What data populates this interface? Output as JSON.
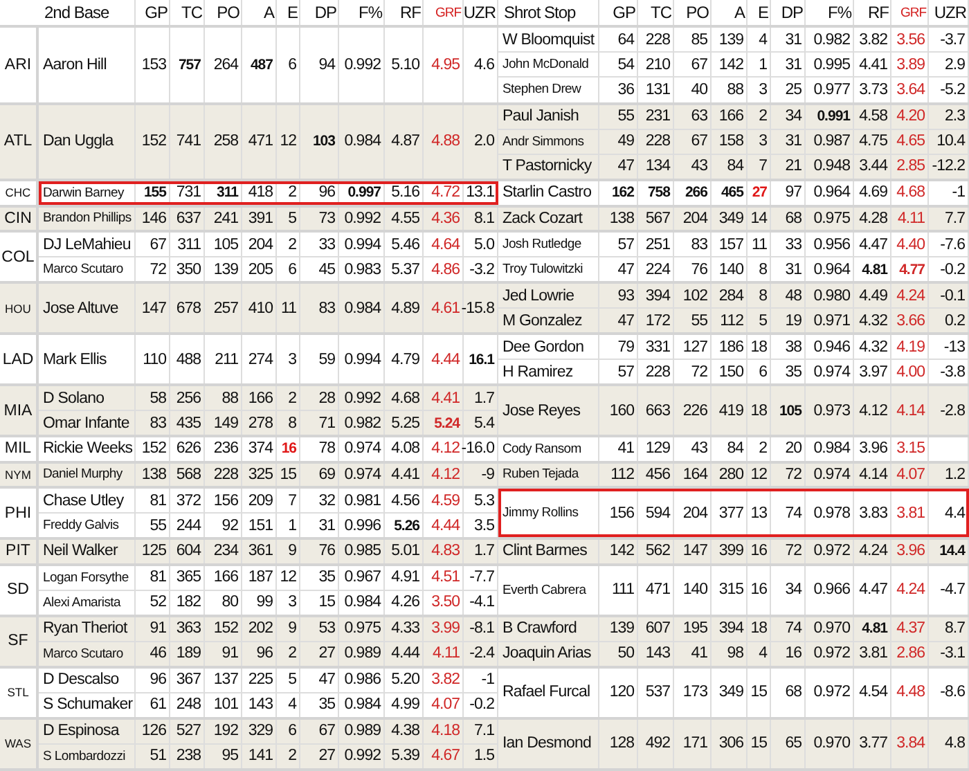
{
  "sections": {
    "second_base": {
      "title": "2nd Base",
      "columns": [
        {
          "label": "GP",
          "accent": false
        },
        {
          "label": "TC",
          "accent": false
        },
        {
          "label": "PO",
          "accent": false
        },
        {
          "label": "A",
          "accent": false
        },
        {
          "label": "E",
          "accent": false
        },
        {
          "label": "DP",
          "accent": false
        },
        {
          "label": "F%",
          "accent": false
        },
        {
          "label": "RF",
          "accent": false
        },
        {
          "label": "GRF",
          "accent": true
        },
        {
          "label": "UZR",
          "accent": false
        }
      ]
    },
    "shortstop": {
      "title": "Shrot Stop",
      "columns": [
        {
          "label": "GP",
          "accent": false
        },
        {
          "label": "TC",
          "accent": false
        },
        {
          "label": "PO",
          "accent": false
        },
        {
          "label": "A",
          "accent": false
        },
        {
          "label": "E",
          "accent": false
        },
        {
          "label": "DP",
          "accent": false
        },
        {
          "label": "F%",
          "accent": false
        },
        {
          "label": "RF",
          "accent": false
        },
        {
          "label": "GRF",
          "accent": true
        },
        {
          "label": "UZR",
          "accent": false
        }
      ]
    }
  },
  "teams": [
    {
      "team": "ARI",
      "small": false,
      "second_base": [
        {
          "name": "Aaron Hill",
          "small": false,
          "highlighted": false,
          "stats": [
            "153",
            {
              "value": "757",
              "bold": true
            },
            "264",
            {
              "value": "487",
              "bold": true
            },
            "6",
            "94",
            "0.992",
            "5.10",
            "4.95",
            "4.6"
          ]
        }
      ],
      "shortstop": [
        {
          "name": "W Bloomquist",
          "small": false,
          "highlighted": false,
          "stats": [
            "64",
            "228",
            "85",
            "139",
            "4",
            "31",
            "0.982",
            "3.82",
            "3.56",
            "-3.7"
          ]
        },
        {
          "name": "John McDonald",
          "small": true,
          "highlighted": false,
          "stats": [
            "54",
            "210",
            "67",
            "142",
            "1",
            "31",
            "0.995",
            "4.41",
            "3.89",
            "2.9"
          ]
        },
        {
          "name": "Stephen Drew",
          "small": true,
          "highlighted": false,
          "stats": [
            "36",
            "131",
            "40",
            "88",
            "3",
            "25",
            "0.977",
            "3.73",
            "3.64",
            "-5.2"
          ]
        }
      ]
    },
    {
      "team": "ATL",
      "small": false,
      "second_base": [
        {
          "name": "Dan Uggla",
          "small": false,
          "highlighted": false,
          "stats": [
            "152",
            "741",
            "258",
            "471",
            "12",
            {
              "value": "103",
              "bold": true
            },
            "0.984",
            "4.87",
            "4.88",
            "2.0"
          ]
        }
      ],
      "shortstop": [
        {
          "name": "Paul Janish",
          "small": false,
          "highlighted": false,
          "stats": [
            "55",
            "231",
            "63",
            "166",
            "2",
            "34",
            {
              "value": "0.991",
              "bold": true
            },
            "4.58",
            "4.20",
            "2.3"
          ]
        },
        {
          "name": "Andr Simmons",
          "small": true,
          "highlighted": false,
          "stats": [
            "49",
            "228",
            "67",
            "158",
            "3",
            "31",
            "0.987",
            "4.75",
            "4.65",
            "10.4"
          ]
        },
        {
          "name": "T Pastornicky",
          "small": false,
          "highlighted": false,
          "stats": [
            "47",
            "134",
            "43",
            "84",
            "7",
            "21",
            "0.948",
            "3.44",
            "2.85",
            "-12.2"
          ]
        }
      ]
    },
    {
      "team": "CHC",
      "small": true,
      "second_base": [
        {
          "name": "Darwin Barney",
          "small": true,
          "highlighted": true,
          "stats": [
            {
              "value": "155",
              "bold": true
            },
            "731",
            {
              "value": "311",
              "bold": true
            },
            "418",
            "2",
            "96",
            {
              "value": "0.997",
              "bold": true
            },
            "5.16",
            "4.72",
            "13.1"
          ]
        }
      ],
      "shortstop": [
        {
          "name": "Starlin Castro",
          "small": false,
          "highlighted": false,
          "stats": [
            {
              "value": "162",
              "bold": true
            },
            {
              "value": "758",
              "bold": true
            },
            {
              "value": "266",
              "bold": true
            },
            {
              "value": "465",
              "bold": true
            },
            {
              "value": "27",
              "bold": true,
              "alert": true
            },
            "97",
            "0.964",
            "4.69",
            "4.68",
            "-1"
          ]
        }
      ]
    },
    {
      "team": "CIN",
      "small": false,
      "second_base": [
        {
          "name": "Brandon Phillips",
          "small": true,
          "highlighted": false,
          "stats": [
            "146",
            "637",
            "241",
            "391",
            "5",
            "73",
            "0.992",
            "4.55",
            "4.36",
            "8.1"
          ]
        }
      ],
      "shortstop": [
        {
          "name": "Zack Cozart",
          "small": false,
          "highlighted": false,
          "stats": [
            "138",
            "567",
            "204",
            "349",
            "14",
            "68",
            "0.975",
            "4.28",
            "4.11",
            "7.7"
          ]
        }
      ]
    },
    {
      "team": "COL",
      "small": false,
      "second_base": [
        {
          "name": "DJ LeMahieu",
          "small": false,
          "highlighted": false,
          "stats": [
            "67",
            "311",
            "105",
            "204",
            "2",
            "33",
            "0.994",
            "5.46",
            "4.64",
            "5.0"
          ]
        },
        {
          "name": "Marco Scutaro",
          "small": true,
          "highlighted": false,
          "stats": [
            "72",
            "350",
            "139",
            "205",
            "6",
            "45",
            "0.983",
            "5.37",
            "4.86",
            "-3.2"
          ]
        }
      ],
      "shortstop": [
        {
          "name": "Josh Rutledge",
          "small": true,
          "highlighted": false,
          "stats": [
            "57",
            "251",
            "83",
            "157",
            "11",
            "33",
            "0.956",
            "4.47",
            "4.40",
            "-7.6"
          ]
        },
        {
          "name": "Troy Tulowitzki",
          "small": true,
          "highlighted": false,
          "stats": [
            "47",
            "224",
            "76",
            "140",
            "8",
            "31",
            "0.964",
            {
              "value": "4.81",
              "bold": true
            },
            {
              "value": "4.77",
              "bold": true
            },
            "-0.2"
          ]
        }
      ]
    },
    {
      "team": "HOU",
      "small": true,
      "second_base": [
        {
          "name": "Jose Altuve",
          "small": false,
          "highlighted": false,
          "stats": [
            "147",
            "678",
            "257",
            "410",
            "11",
            "83",
            "0.984",
            "4.89",
            "4.61",
            "-15.8"
          ]
        }
      ],
      "shortstop": [
        {
          "name": "Jed Lowrie",
          "small": false,
          "highlighted": false,
          "stats": [
            "93",
            "394",
            "102",
            "284",
            "8",
            "48",
            "0.980",
            "4.49",
            "4.24",
            "-0.1"
          ]
        },
        {
          "name": "M Gonzalez",
          "small": false,
          "highlighted": false,
          "stats": [
            "47",
            "172",
            "55",
            "112",
            "5",
            "19",
            "0.971",
            "4.32",
            "3.66",
            "0.2"
          ]
        }
      ]
    },
    {
      "team": "LAD",
      "small": false,
      "second_base": [
        {
          "name": "Mark Ellis",
          "small": false,
          "highlighted": false,
          "stats": [
            "110",
            "488",
            "211",
            "274",
            "3",
            "59",
            "0.994",
            "4.79",
            "4.44",
            {
              "value": "16.1",
              "bold": true
            }
          ]
        }
      ],
      "shortstop": [
        {
          "name": "Dee Gordon",
          "small": false,
          "highlighted": false,
          "stats": [
            "79",
            "331",
            "127",
            "186",
            "18",
            "38",
            "0.946",
            "4.32",
            "4.19",
            "-13"
          ]
        },
        {
          "name": "H Ramirez",
          "small": false,
          "highlighted": false,
          "stats": [
            "57",
            "228",
            "72",
            "150",
            "6",
            "35",
            "0.974",
            "3.97",
            "4.00",
            "-3.8"
          ]
        }
      ]
    },
    {
      "team": "MIA",
      "small": false,
      "second_base": [
        {
          "name": "D Solano",
          "small": false,
          "highlighted": false,
          "stats": [
            "58",
            "256",
            "88",
            "166",
            "2",
            "28",
            "0.992",
            "4.68",
            "4.41",
            "1.7"
          ]
        },
        {
          "name": "Omar Infante",
          "small": false,
          "highlighted": false,
          "stats": [
            "83",
            "435",
            "149",
            "278",
            "8",
            "71",
            "0.982",
            "5.25",
            {
              "value": "5.24",
              "bold": true
            },
            "5.4"
          ]
        }
      ],
      "shortstop": [
        {
          "name": "Jose Reyes",
          "small": false,
          "highlighted": false,
          "stats": [
            "160",
            "663",
            "226",
            "419",
            "18",
            {
              "value": "105",
              "bold": true
            },
            "0.973",
            "4.12",
            "4.14",
            "-2.8"
          ]
        }
      ]
    },
    {
      "team": "MIL",
      "small": false,
      "second_base": [
        {
          "name": "Rickie Weeks",
          "small": false,
          "highlighted": false,
          "stats": [
            "152",
            "626",
            "236",
            "374",
            {
              "value": "16",
              "bold": true,
              "alert": true
            },
            "78",
            "0.974",
            "4.08",
            "4.12",
            "-16.0"
          ]
        }
      ],
      "shortstop": [
        {
          "name": "Cody Ransom",
          "small": true,
          "highlighted": false,
          "stats": [
            "41",
            "129",
            "43",
            "84",
            "2",
            "20",
            "0.984",
            "3.96",
            "3.15"
          ]
        }
      ]
    },
    {
      "team": "NYM",
      "small": true,
      "second_base": [
        {
          "name": "Daniel Murphy",
          "small": true,
          "highlighted": false,
          "stats": [
            "138",
            "568",
            "228",
            "325",
            "15",
            "69",
            "0.974",
            "4.41",
            "4.12",
            "-9"
          ]
        }
      ],
      "shortstop": [
        {
          "name": "Ruben Tejada",
          "small": true,
          "highlighted": false,
          "stats": [
            "112",
            "456",
            "164",
            "280",
            "12",
            "72",
            "0.974",
            "4.14",
            "4.07",
            "1.2"
          ]
        }
      ]
    },
    {
      "team": "PHI",
      "small": false,
      "second_base": [
        {
          "name": "Chase Utley",
          "small": false,
          "highlighted": false,
          "stats": [
            "81",
            "372",
            "156",
            "209",
            "7",
            "32",
            "0.981",
            "4.56",
            "4.59",
            "5.3"
          ]
        },
        {
          "name": "Freddy Galvis",
          "small": true,
          "highlighted": false,
          "stats": [
            "55",
            "244",
            "92",
            "151",
            "1",
            "31",
            "0.996",
            {
              "value": "5.26",
              "bold": true
            },
            "4.44",
            "3.5"
          ]
        }
      ],
      "shortstop": [
        {
          "name": "Jimmy Rollins",
          "small": true,
          "highlighted": true,
          "stats": [
            "156",
            "594",
            "204",
            "377",
            "13",
            "74",
            "0.978",
            "3.83",
            "3.81",
            "4.4"
          ]
        }
      ]
    },
    {
      "team": "PIT",
      "small": false,
      "second_base": [
        {
          "name": "Neil Walker",
          "small": false,
          "highlighted": false,
          "stats": [
            "125",
            "604",
            "234",
            "361",
            "9",
            "76",
            "0.985",
            "5.01",
            "4.83",
            "1.7"
          ]
        }
      ],
      "shortstop": [
        {
          "name": "Clint Barmes",
          "small": false,
          "highlighted": false,
          "stats": [
            "142",
            "562",
            "147",
            "399",
            "16",
            "72",
            "0.972",
            "4.24",
            "3.96",
            {
              "value": "14.4",
              "bold": true
            }
          ]
        }
      ]
    },
    {
      "team": "SD",
      "small": false,
      "second_base": [
        {
          "name": "Logan Forsythe",
          "small": true,
          "highlighted": false,
          "stats": [
            "81",
            "365",
            "166",
            "187",
            "12",
            "35",
            "0.967",
            "4.91",
            "4.51",
            "-7.7"
          ]
        },
        {
          "name": "Alexi Amarista",
          "small": true,
          "highlighted": false,
          "stats": [
            "52",
            "182",
            "80",
            "99",
            "3",
            "15",
            "0.984",
            "4.26",
            "3.50",
            "-4.1"
          ]
        }
      ],
      "shortstop": [
        {
          "name": "Everth Cabrera",
          "small": true,
          "highlighted": false,
          "stats": [
            "111",
            "471",
            "140",
            "315",
            "16",
            "34",
            "0.966",
            "4.47",
            "4.24",
            "-4.7"
          ]
        }
      ]
    },
    {
      "team": "SF",
      "small": false,
      "second_base": [
        {
          "name": "Ryan Theriot",
          "small": false,
          "highlighted": false,
          "stats": [
            "91",
            "363",
            "152",
            "202",
            "9",
            "53",
            "0.975",
            "4.33",
            "3.99",
            "-8.1"
          ]
        },
        {
          "name": "Marco Scutaro",
          "small": true,
          "highlighted": false,
          "stats": [
            "46",
            "189",
            "91",
            "96",
            "2",
            "27",
            "0.989",
            "4.44",
            "4.11",
            "-2.4"
          ]
        }
      ],
      "shortstop": [
        {
          "name": "B Crawford",
          "small": false,
          "highlighted": false,
          "stats": [
            "139",
            "607",
            "195",
            "394",
            "18",
            "74",
            "0.970",
            {
              "value": "4.81",
              "bold": true
            },
            "4.37",
            "8.7"
          ]
        },
        {
          "name": "Joaquin Arias",
          "small": false,
          "highlighted": false,
          "stats": [
            "50",
            "143",
            "41",
            "98",
            "4",
            "16",
            "0.972",
            "3.81",
            "2.86",
            "-3.1"
          ]
        }
      ]
    },
    {
      "team": "STL",
      "small": true,
      "second_base": [
        {
          "name": "D Descalso",
          "small": false,
          "highlighted": false,
          "stats": [
            "96",
            "367",
            "137",
            "225",
            "5",
            "47",
            "0.986",
            "5.20",
            "3.82",
            "-1"
          ]
        },
        {
          "name": "S Schumaker",
          "small": false,
          "highlighted": false,
          "stats": [
            "61",
            "248",
            "101",
            "143",
            "4",
            "35",
            "0.984",
            "4.99",
            "4.07",
            "-0.2"
          ]
        }
      ],
      "shortstop": [
        {
          "name": "Rafael Furcal",
          "small": false,
          "highlighted": false,
          "stats": [
            "120",
            "537",
            "173",
            "349",
            "15",
            "68",
            "0.972",
            "4.54",
            "4.48",
            "-8.6"
          ]
        }
      ]
    },
    {
      "team": "WAS",
      "small": true,
      "second_base": [
        {
          "name": "D Espinosa",
          "small": false,
          "highlighted": false,
          "stats": [
            "126",
            "527",
            "192",
            "329",
            "6",
            "67",
            "0.989",
            "4.38",
            "4.18",
            "7.1"
          ]
        },
        {
          "name": "S Lombardozzi",
          "small": true,
          "highlighted": false,
          "stats": [
            "51",
            "238",
            "95",
            "141",
            "2",
            "27",
            "0.992",
            "5.39",
            "4.67",
            "1.5"
          ]
        }
      ],
      "shortstop": [
        {
          "name": "Ian Desmond",
          "small": false,
          "highlighted": false,
          "stats": [
            "128",
            "492",
            "171",
            "306",
            "15",
            "65",
            "0.970",
            "3.77",
            "3.84",
            "4.8"
          ]
        }
      ]
    }
  ]
}
